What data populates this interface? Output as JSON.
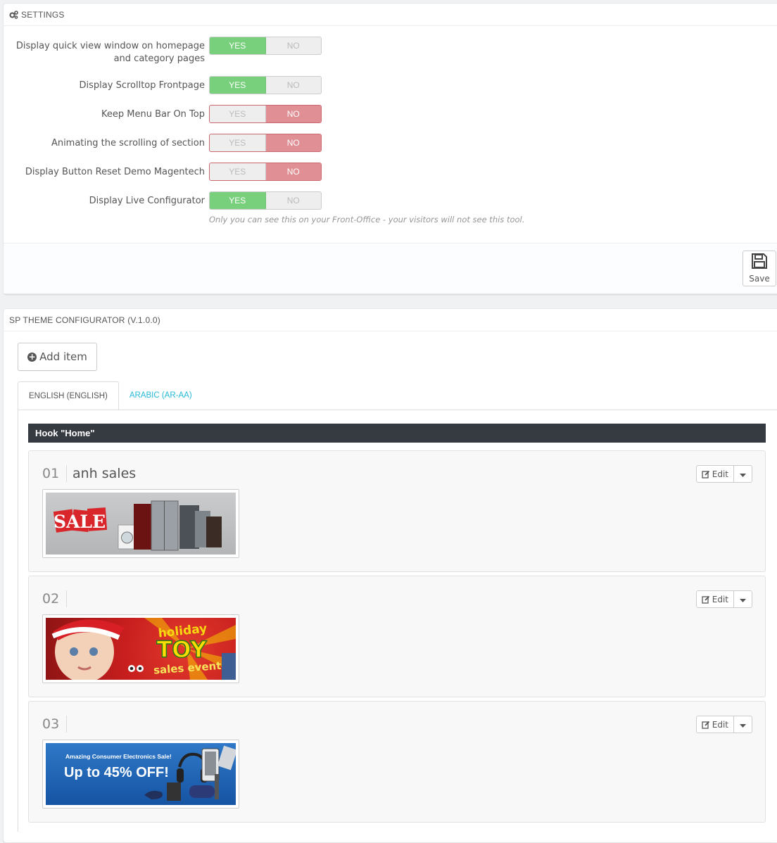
{
  "settings": {
    "title": "SETTINGS",
    "rows": [
      {
        "label": "Display quick view window on homepage and category pages",
        "yes": "YES",
        "no": "NO",
        "value": "yes"
      },
      {
        "label": "Display Scrolltop Frontpage",
        "yes": "YES",
        "no": "NO",
        "value": "yes"
      },
      {
        "label": "Keep Menu Bar On Top",
        "yes": "YES",
        "no": "NO",
        "value": "no"
      },
      {
        "label": "Animating the scrolling of section",
        "yes": "YES",
        "no": "NO",
        "value": "no"
      },
      {
        "label": "Display Button Reset Demo Magentech",
        "yes": "YES",
        "no": "NO",
        "value": "no"
      },
      {
        "label": "Display Live Configurator",
        "yes": "YES",
        "no": "NO",
        "value": "yes"
      }
    ],
    "help": "Only you can see this on your Front-Office - your visitors will not see this tool.",
    "save_label": "Save"
  },
  "configurator": {
    "title": "SP THEME CONFIGURATOR (V.1.0.0)",
    "add_label": "Add item",
    "tabs": [
      {
        "label": "ENGLISH (ENGLISH)",
        "active": true
      },
      {
        "label": "ARABIC (AR-AA)",
        "active": false
      }
    ],
    "hook_title": "Hook \"Home\"",
    "items": [
      {
        "num": "01",
        "title": "anh sales",
        "edit_label": "Edit",
        "banner": {
          "word": "SALE"
        }
      },
      {
        "num": "02",
        "title": "",
        "edit_label": "Edit",
        "banner": {
          "line1": "holiday",
          "line2": "TOY",
          "line3": "sales event!"
        }
      },
      {
        "num": "03",
        "title": "",
        "edit_label": "Edit",
        "banner": {
          "line1": "Amazing Consumer Electronics Sale!",
          "line2": "Up to 45% OFF!"
        }
      }
    ]
  },
  "colors": {
    "yes_active": "#78d07d",
    "no_active": "#e08f95",
    "hook_bar": "#363a41",
    "tab_link": "#25b9d7"
  }
}
